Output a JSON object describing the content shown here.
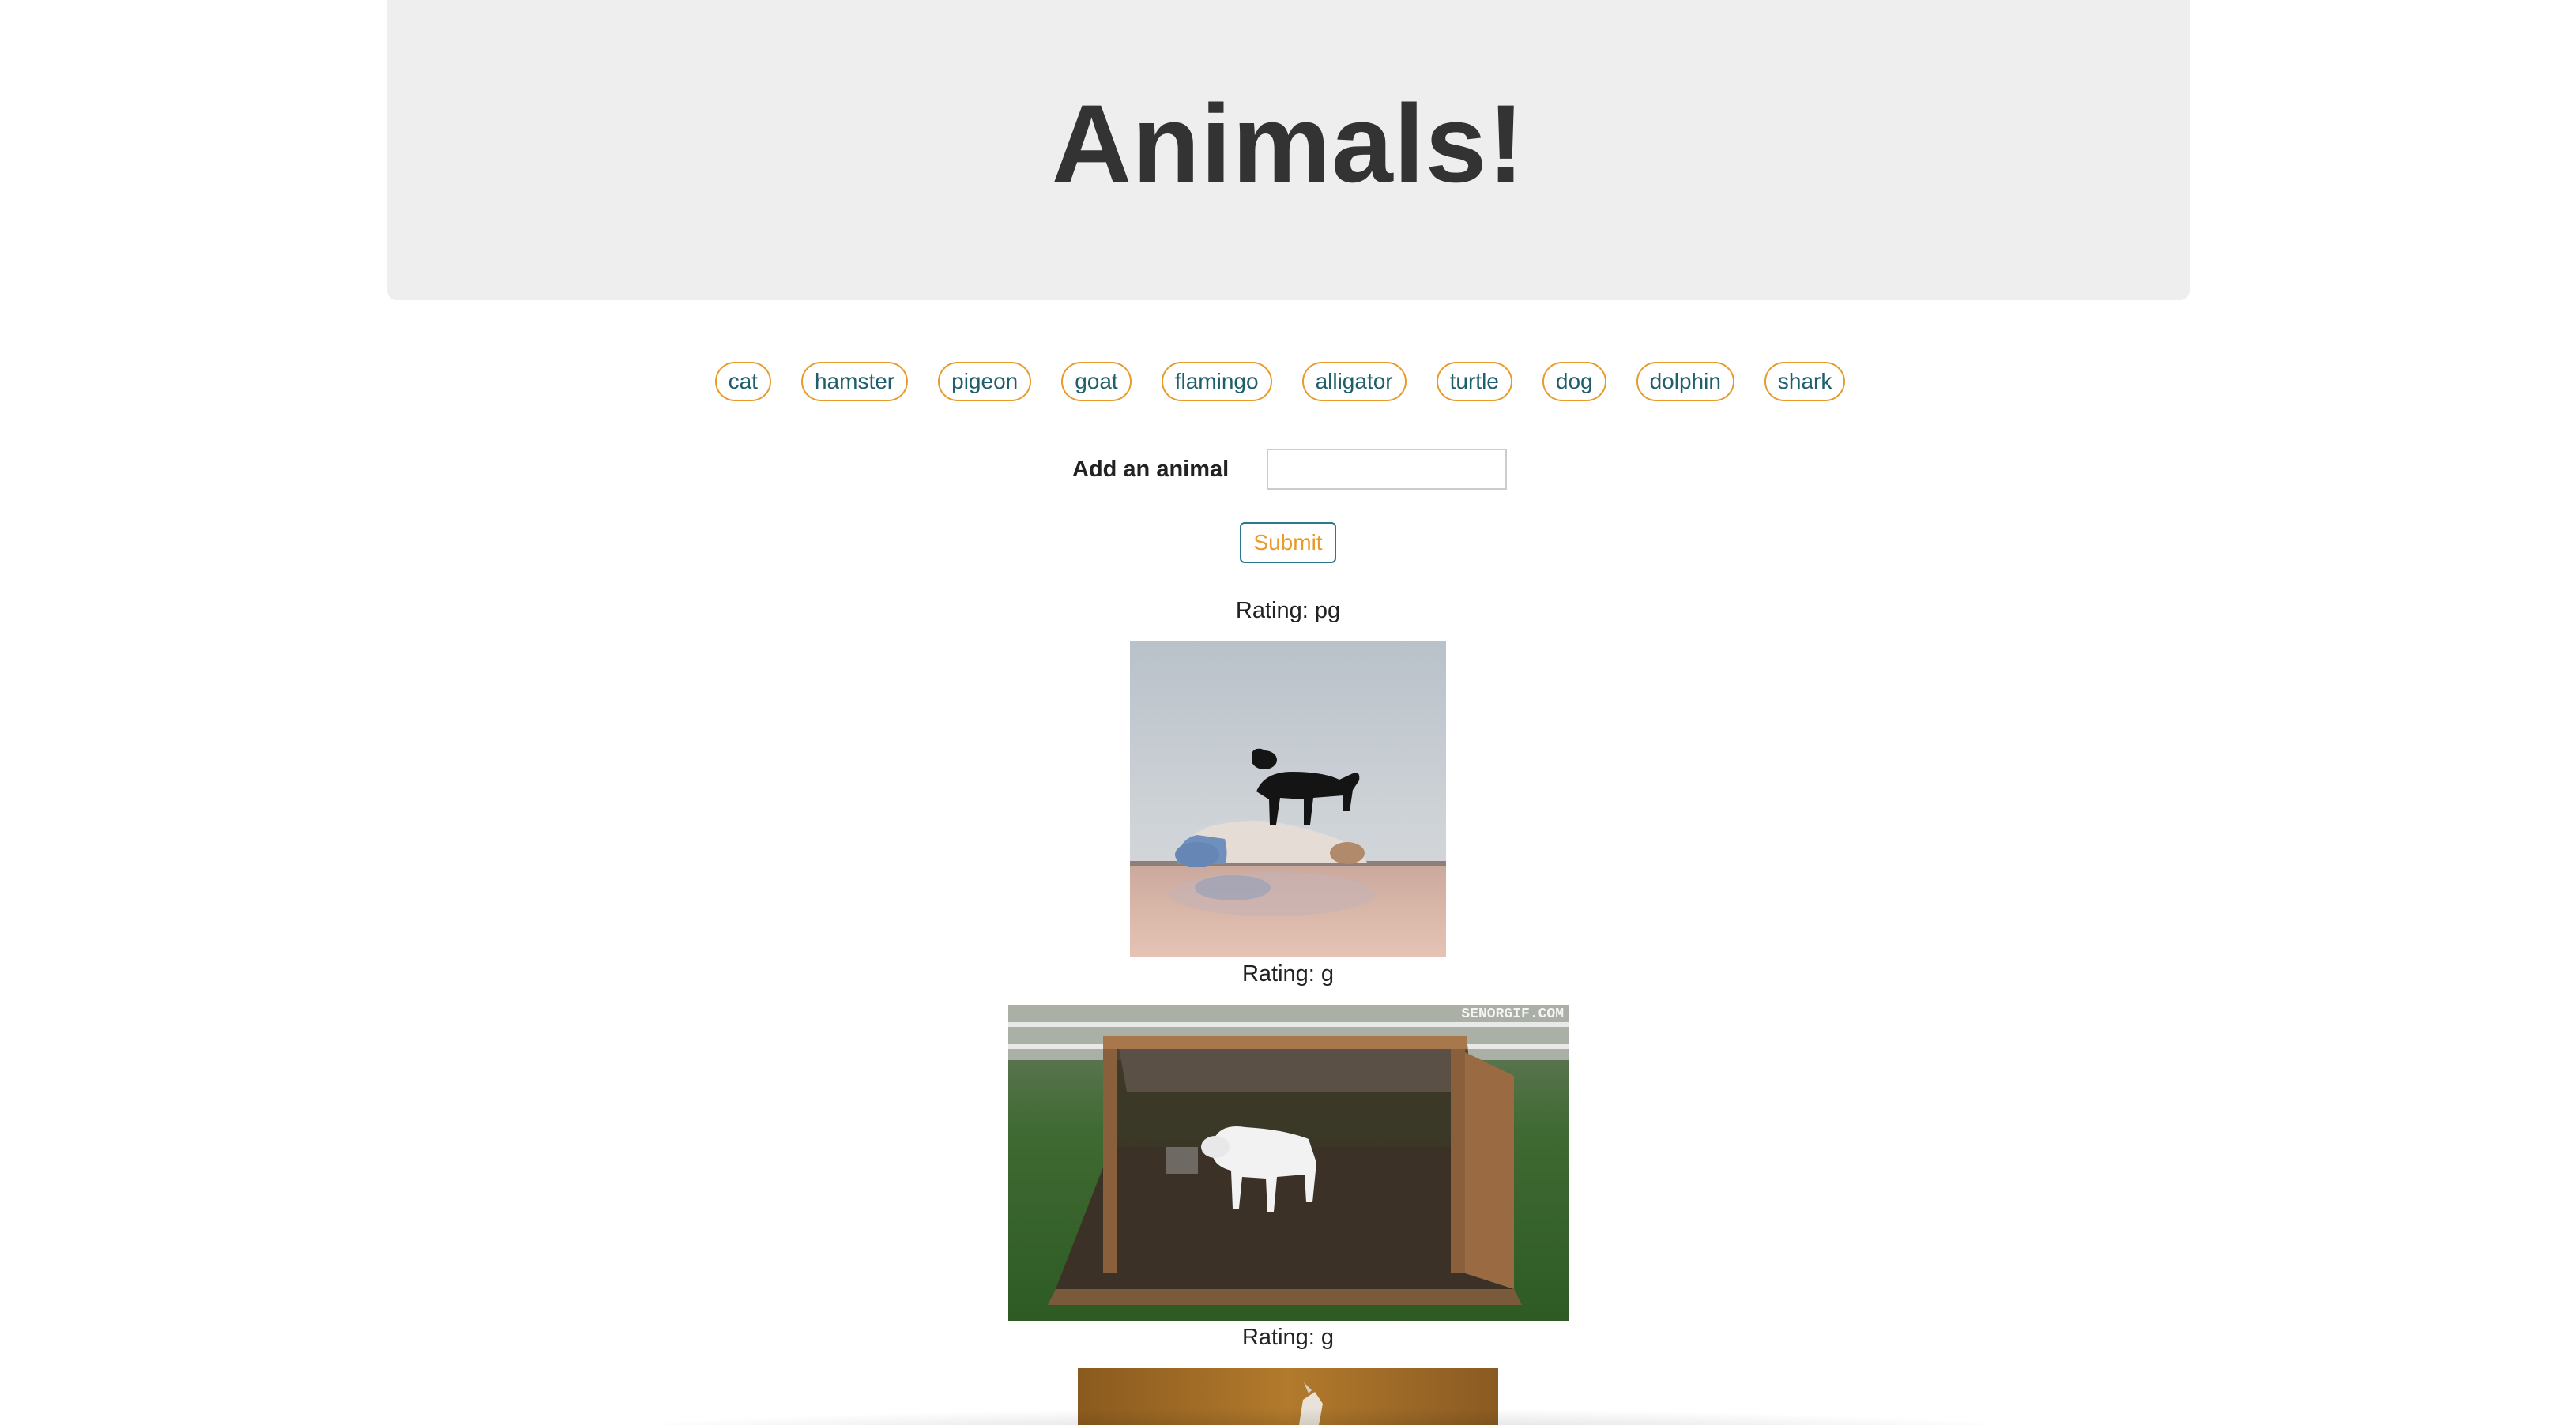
{
  "header": {
    "title": "Animals!"
  },
  "animal_buttons": [
    "cat",
    "hamster",
    "pigeon",
    "goat",
    "flamingo",
    "alligator",
    "turtle",
    "dog",
    "dolphin",
    "shark"
  ],
  "form": {
    "label": "Add an animal",
    "input_value": "",
    "submit_label": "Submit"
  },
  "results": [
    {
      "rating": "Rating: pg",
      "image": "goat-yoga-gif"
    },
    {
      "rating": "Rating: g",
      "image": "goat-pen-gif",
      "watermark": "SENORGIF.COM"
    },
    {
      "rating": "Rating: g",
      "image": "goat-gif-partial"
    }
  ],
  "colors": {
    "button_border": "#e89a2b",
    "button_text": "#1f5f6b",
    "submit_border": "#2b7a8c",
    "jumbotron_bg": "#eeeeee"
  }
}
